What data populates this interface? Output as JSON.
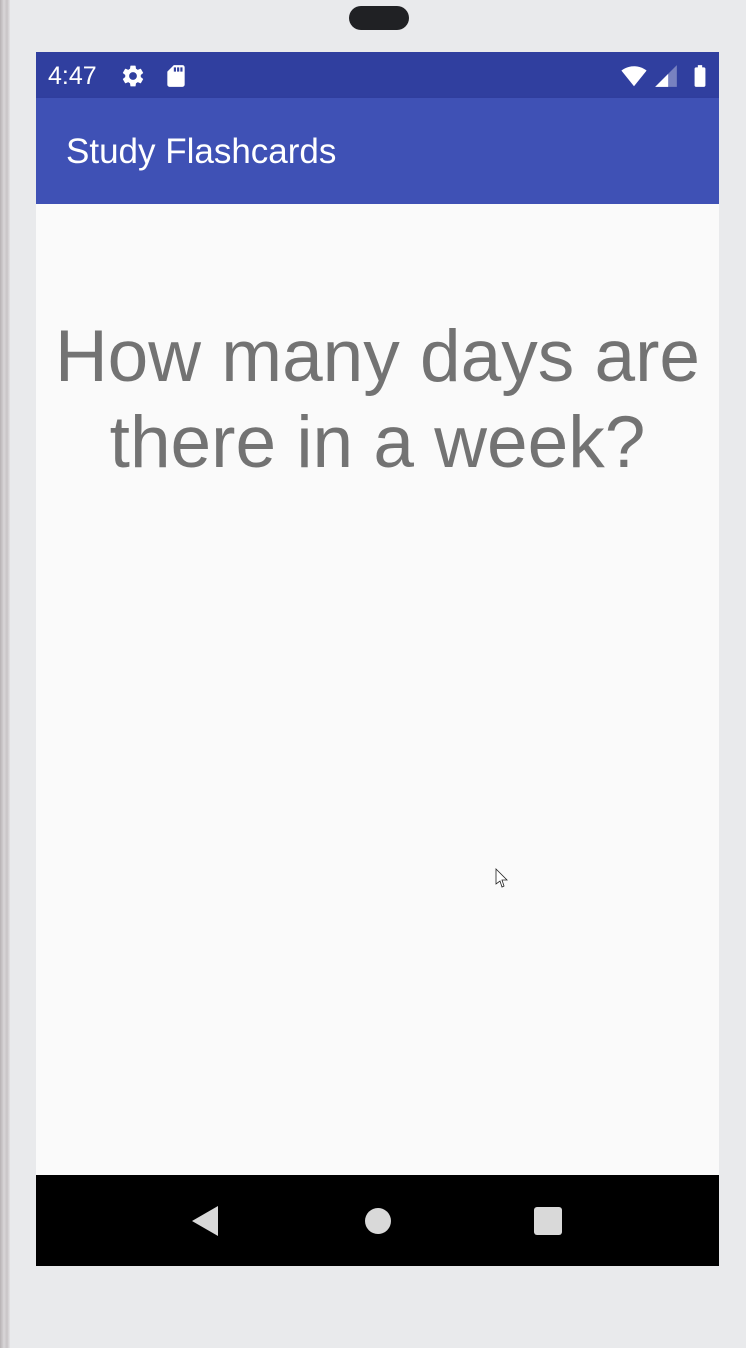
{
  "status_bar": {
    "time": "4:47",
    "icons": [
      "settings-icon",
      "sd-card-icon",
      "wifi-icon",
      "cell-signal-icon",
      "battery-icon"
    ],
    "background_color": "#303f9f"
  },
  "app_bar": {
    "title": "Study Flashcards",
    "background_color": "#3f51b5"
  },
  "flashcard": {
    "question": "How many days are there in a week?"
  },
  "nav_bar": {
    "buttons": [
      "back-icon",
      "home-icon",
      "recents-icon"
    ]
  }
}
